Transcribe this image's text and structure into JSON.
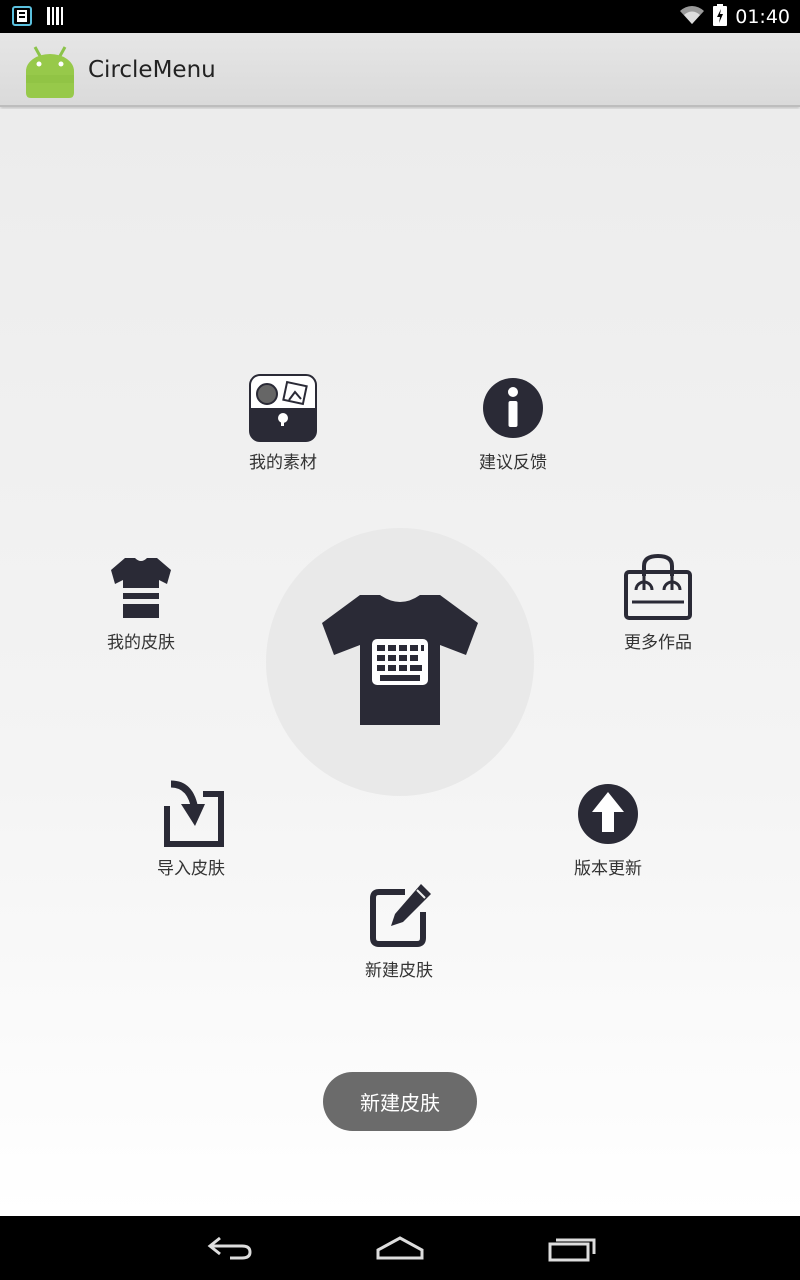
{
  "status_bar": {
    "time": "01:40"
  },
  "app": {
    "title": "CircleMenu",
    "launcher_icon": "android-robot-icon"
  },
  "colors": {
    "icon_dark": "#2a2a36",
    "circle_bg": "#e9e9e9",
    "pill_bg": "#6b6b6b"
  },
  "center": {
    "icon": "tshirt-keyboard-icon"
  },
  "menu": [
    {
      "key": "materials",
      "label": "我的素材",
      "icon": "materials-icon"
    },
    {
      "key": "feedback",
      "label": "建议反馈",
      "icon": "info-icon"
    },
    {
      "key": "my_skins",
      "label": "我的皮肤",
      "icon": "shirt-icon"
    },
    {
      "key": "more_works",
      "label": "更多作品",
      "icon": "shopping-bag-icon"
    },
    {
      "key": "import_skin",
      "label": "导入皮肤",
      "icon": "import-icon"
    },
    {
      "key": "update",
      "label": "版本更新",
      "icon": "upload-arrow-icon"
    },
    {
      "key": "new_skin",
      "label": "新建皮肤",
      "icon": "edit-icon"
    }
  ],
  "toast": {
    "label": "新建皮肤"
  },
  "nav_bar": {
    "back": "back-icon",
    "home": "home-icon",
    "recents": "recents-icon"
  }
}
